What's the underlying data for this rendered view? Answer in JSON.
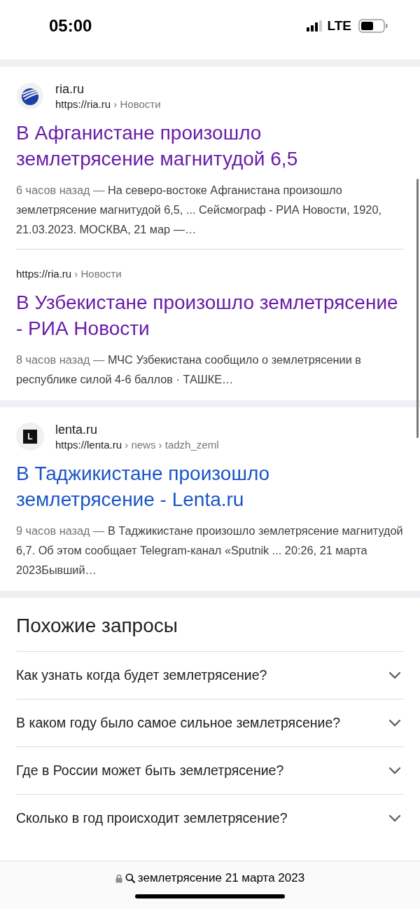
{
  "status_bar": {
    "time": "05:00",
    "network": "LTE"
  },
  "results": [
    {
      "site": "ria.ru",
      "logo": {
        "kind": "globe"
      },
      "url": "https://ria.ru",
      "path": [
        "› Новости"
      ],
      "title": "В Афганистане произошло землетрясение магнитудой 6,5",
      "visited": true,
      "age": "6 часов назад —",
      "snippet": "На северо-востоке Афганистана произошло землетрясение магнитудой 6,5, ... Сейсмограф - РИА Новости, 1920, 21.03.2023. МОСКВА, 21 мар —…",
      "sub": {
        "url": "https://ria.ru",
        "path": [
          "› Новости"
        ],
        "title": "В Узбекистане произошло землетрясение - РИА Новости",
        "visited": true,
        "age": "8 часов назад —",
        "snippet": "МЧС Узбекистана сообщило о землетрясении в республике силой 4-6 баллов · ТАШКЕ…"
      }
    },
    {
      "site": "lenta.ru",
      "logo": {
        "kind": "letter",
        "text": "L"
      },
      "url": "https://lenta.ru",
      "path": [
        "› news",
        "› tadzh_zeml"
      ],
      "title": "В Таджикистане произошло землетрясение - Lenta.ru",
      "visited": false,
      "age": "9 часов назад —",
      "snippet": "В Таджикистане произошло землетрясение магнитудой 6,7. Об этом сообщает Telegram-канал «Sputnik ... 20:26, 21 марта 2023Бывший…"
    }
  ],
  "related": {
    "title": "Похожие запросы",
    "items": [
      {
        "text": "Как узнать когда будет землетрясение?",
        "expanded": false
      },
      {
        "text": "В каком году было самое сильное землетрясение?",
        "expanded": false
      },
      {
        "text": "Где в России может быть землетрясение?",
        "expanded": false
      },
      {
        "text": "Сколько в год происходит землетрясение?",
        "expanded": false
      }
    ]
  },
  "address_bar": {
    "secure": true,
    "query": "землетрясение 21 марта 2023"
  }
}
